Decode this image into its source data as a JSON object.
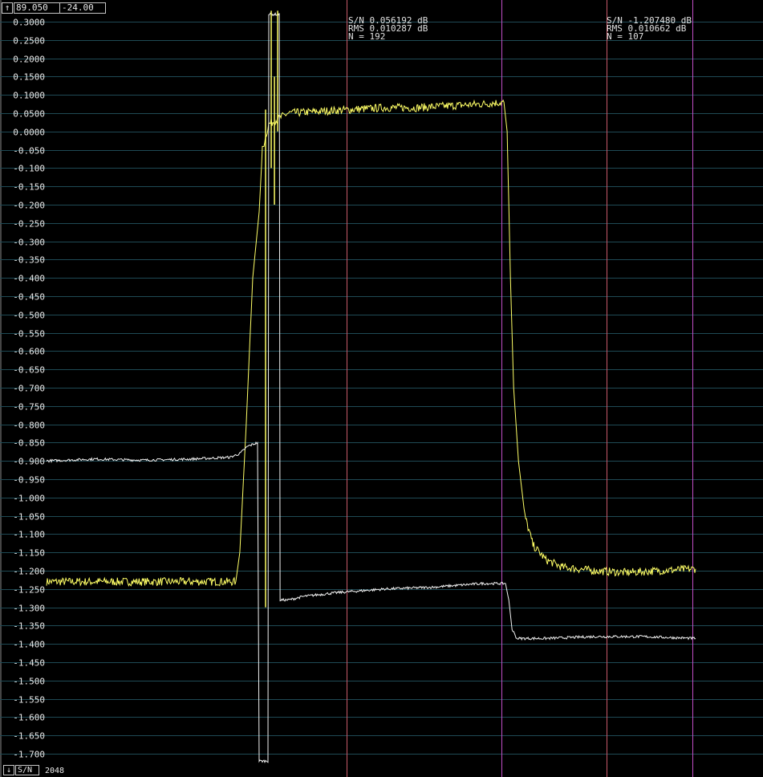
{
  "header": {
    "up_arrow": "↑",
    "value_a": "89.050",
    "value_b": "-24.00"
  },
  "footer": {
    "down_arrow": "↓",
    "mode": "S/N",
    "count": "2048"
  },
  "stats": [
    {
      "sn": "S/N 0.056192 dB",
      "rms": "RMS 0.010287 dB",
      "n": "N = 192"
    },
    {
      "sn": "S/N -1.207480 dB",
      "rms": "RMS 0.010662 dB",
      "n": "N = 107"
    }
  ],
  "colors": {
    "background": "#000000",
    "grid": "#1f4a55",
    "yellow_trace": "#ffff66",
    "white_trace": "#f2f2f2",
    "cursor_red": "#c85a6a",
    "cursor_magenta": "#c24fc8"
  },
  "chart_data": {
    "type": "line",
    "ylim": [
      -1.74,
      0.33
    ],
    "x_unit": "sample index (0-800)",
    "y_ticks": [
      "0.3000",
      "0.2500",
      "0.2000",
      "0.1500",
      "0.1000",
      "0.0500",
      "0.0000",
      "-0.050",
      "-0.100",
      "-0.150",
      "-0.200",
      "-0.250",
      "-0.300",
      "-0.350",
      "-0.400",
      "-0.450",
      "-0.500",
      "-0.550",
      "-0.600",
      "-0.650",
      "-0.700",
      "-0.750",
      "-0.800",
      "-0.850",
      "-0.900",
      "-0.950",
      "-1.000",
      "-1.050",
      "-1.100",
      "-1.150",
      "-1.200",
      "-1.250",
      "-1.300",
      "-1.350",
      "-1.400",
      "-1.450",
      "-1.500",
      "-1.550",
      "-1.600",
      "-1.650",
      "-1.700"
    ],
    "y_tick_values": [
      0.3,
      0.25,
      0.2,
      0.15,
      0.1,
      0.05,
      0.0,
      -0.05,
      -0.1,
      -0.15,
      -0.2,
      -0.25,
      -0.3,
      -0.35,
      -0.4,
      -0.45,
      -0.5,
      -0.55,
      -0.6,
      -0.65,
      -0.7,
      -0.75,
      -0.8,
      -0.85,
      -0.9,
      -0.95,
      -1.0,
      -1.05,
      -1.1,
      -1.15,
      -1.2,
      -1.25,
      -1.3,
      -1.35,
      -1.4,
      -1.45,
      -1.5,
      -1.55,
      -1.6,
      -1.65,
      -1.7
    ],
    "cursors": [
      {
        "x": 373,
        "color": "red"
      },
      {
        "x": 565,
        "color": "magenta"
      },
      {
        "x": 695,
        "color": "red"
      },
      {
        "x": 802,
        "color": "magenta"
      }
    ],
    "series": [
      {
        "color": "yellow",
        "points": [
          [
            0,
            -1.23
          ],
          [
            235,
            -1.23
          ],
          [
            240,
            -1.15
          ],
          [
            248,
            -0.8
          ],
          [
            256,
            -0.4
          ],
          [
            264,
            -0.22
          ],
          [
            268,
            -0.05
          ],
          [
            276,
            0.02
          ],
          [
            284,
            0.03
          ],
          [
            292,
            0.04
          ],
          [
            300,
            0.05
          ],
          [
            340,
            0.055
          ],
          [
            380,
            0.06
          ],
          [
            420,
            0.065
          ],
          [
            460,
            0.065
          ],
          [
            500,
            0.07
          ],
          [
            540,
            0.075
          ],
          [
            568,
            0.08
          ],
          [
            572,
            0.0
          ],
          [
            576,
            -0.4
          ],
          [
            580,
            -0.7
          ],
          [
            586,
            -0.9
          ],
          [
            594,
            -1.05
          ],
          [
            604,
            -1.13
          ],
          [
            620,
            -1.17
          ],
          [
            640,
            -1.19
          ],
          [
            680,
            -1.2
          ],
          [
            720,
            -1.205
          ],
          [
            760,
            -1.2
          ],
          [
            806,
            -1.195
          ]
        ]
      },
      {
        "color": "white",
        "points": [
          [
            0,
            -0.9
          ],
          [
            60,
            -0.895
          ],
          [
            120,
            -0.898
          ],
          [
            180,
            -0.895
          ],
          [
            228,
            -0.89
          ],
          [
            240,
            -0.88
          ],
          [
            250,
            -0.86
          ],
          [
            262,
            -0.85
          ],
          [
            264,
            -1.72
          ],
          [
            276,
            -1.72
          ],
          [
            276,
            0.32
          ],
          [
            290,
            0.32
          ],
          [
            290,
            -1.28
          ],
          [
            300,
            -1.28
          ],
          [
            320,
            -1.27
          ],
          [
            360,
            -1.26
          ],
          [
            420,
            -1.25
          ],
          [
            480,
            -1.245
          ],
          [
            540,
            -1.235
          ],
          [
            570,
            -1.235
          ],
          [
            574,
            -1.28
          ],
          [
            578,
            -1.36
          ],
          [
            584,
            -1.385
          ],
          [
            620,
            -1.385
          ],
          [
            680,
            -1.38
          ],
          [
            740,
            -1.38
          ],
          [
            806,
            -1.385
          ]
        ]
      }
    ]
  }
}
